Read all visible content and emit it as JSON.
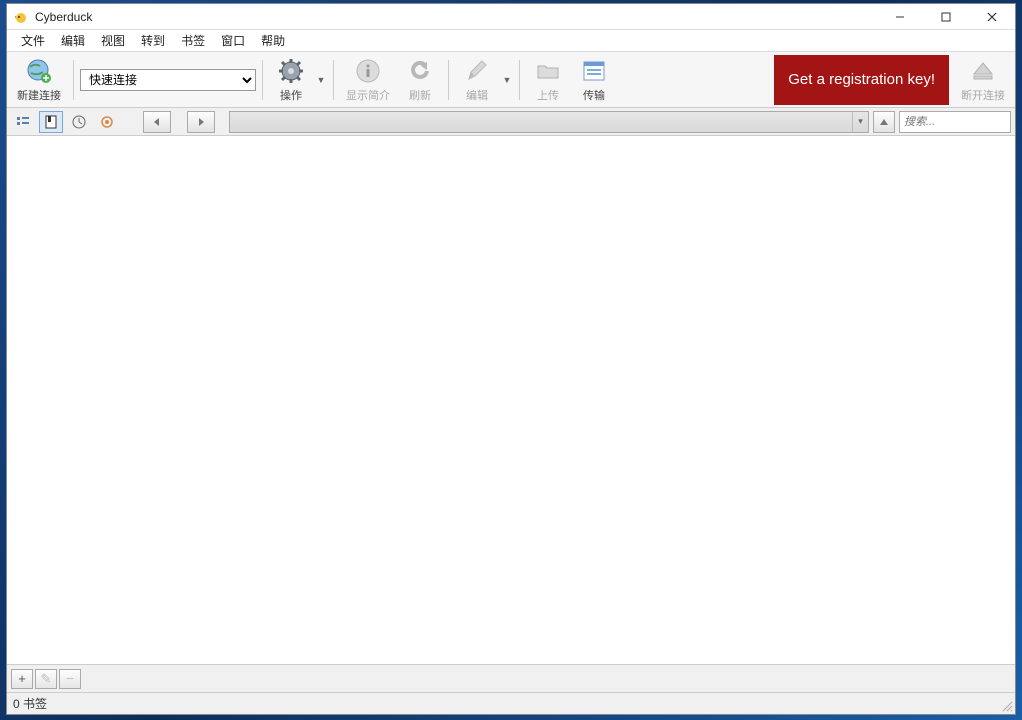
{
  "window": {
    "title": "Cyberduck"
  },
  "menu": {
    "file": "文件",
    "edit": "编辑",
    "view": "视图",
    "go": "转到",
    "bookmarks": "书签",
    "window": "窗口",
    "help": "帮助"
  },
  "toolbar": {
    "new_connection": "新建连接",
    "quick_connect": "快速连接",
    "action": "操作",
    "show_info": "显示简介",
    "refresh": "刷新",
    "edit": "编辑",
    "upload": "上传",
    "transfer": "传输",
    "disconnect": "断开连接",
    "registration": "Get a registration key!"
  },
  "search": {
    "placeholder": "搜索..."
  },
  "bottom": {
    "add": "+",
    "edit": "✎",
    "remove": "−"
  },
  "status": {
    "bookmarks": "0 书签"
  }
}
